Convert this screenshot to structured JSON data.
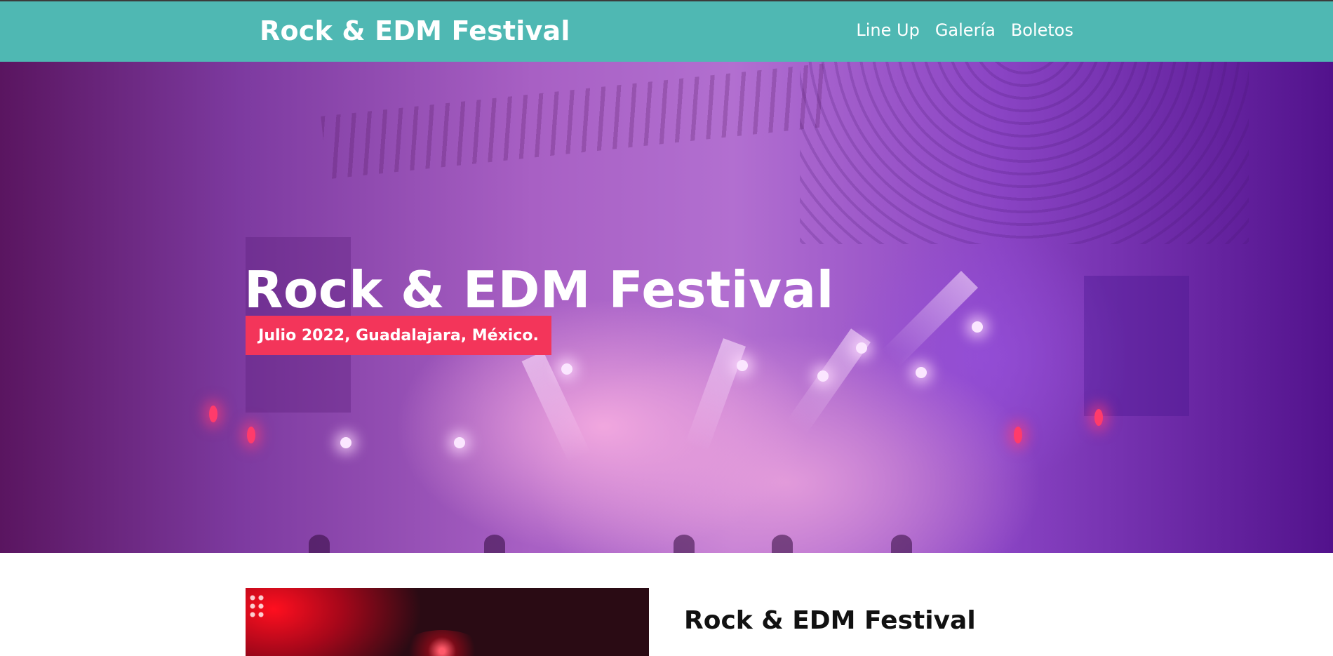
{
  "header": {
    "brand": "Rock & EDM Festival",
    "nav": [
      {
        "label": "Line Up"
      },
      {
        "label": "Galería"
      },
      {
        "label": "Boletos"
      }
    ]
  },
  "hero": {
    "title": "Rock & EDM Festival",
    "subtitle": "Julio 2022, Guadalajara, México."
  },
  "about": {
    "title": "Rock & EDM Festival"
  },
  "colors": {
    "header_bg": "#4fb8b3",
    "badge_bg": "#f3355a",
    "text_light": "#ffffff",
    "text_dark": "#111111"
  }
}
